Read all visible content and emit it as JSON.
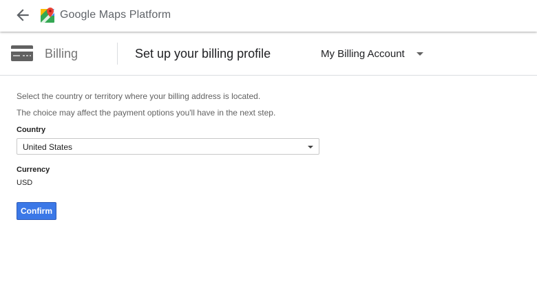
{
  "header": {
    "brand_text": "Google Maps Platform",
    "back_icon": "arrow-left-icon",
    "logo_icon": "google-maps-pin-icon"
  },
  "subheader": {
    "section_label": "Billing",
    "section_icon": "credit-card-icon",
    "title": "Set up your billing profile",
    "account_selector": {
      "selected": "My Billing Account",
      "icon": "caret-down-icon"
    }
  },
  "form": {
    "description_line1": "Select the country or territory where your billing address is located.",
    "description_line2": "The choice may affect the payment options you'll have in the next step.",
    "country_label": "Country",
    "country_selected": "United States",
    "currency_label": "Currency",
    "currency_value": "USD",
    "confirm_label": "Confirm"
  },
  "colors": {
    "primary_button": "#3b78e7",
    "divider": "#dadce0",
    "muted_text": "#757575"
  }
}
